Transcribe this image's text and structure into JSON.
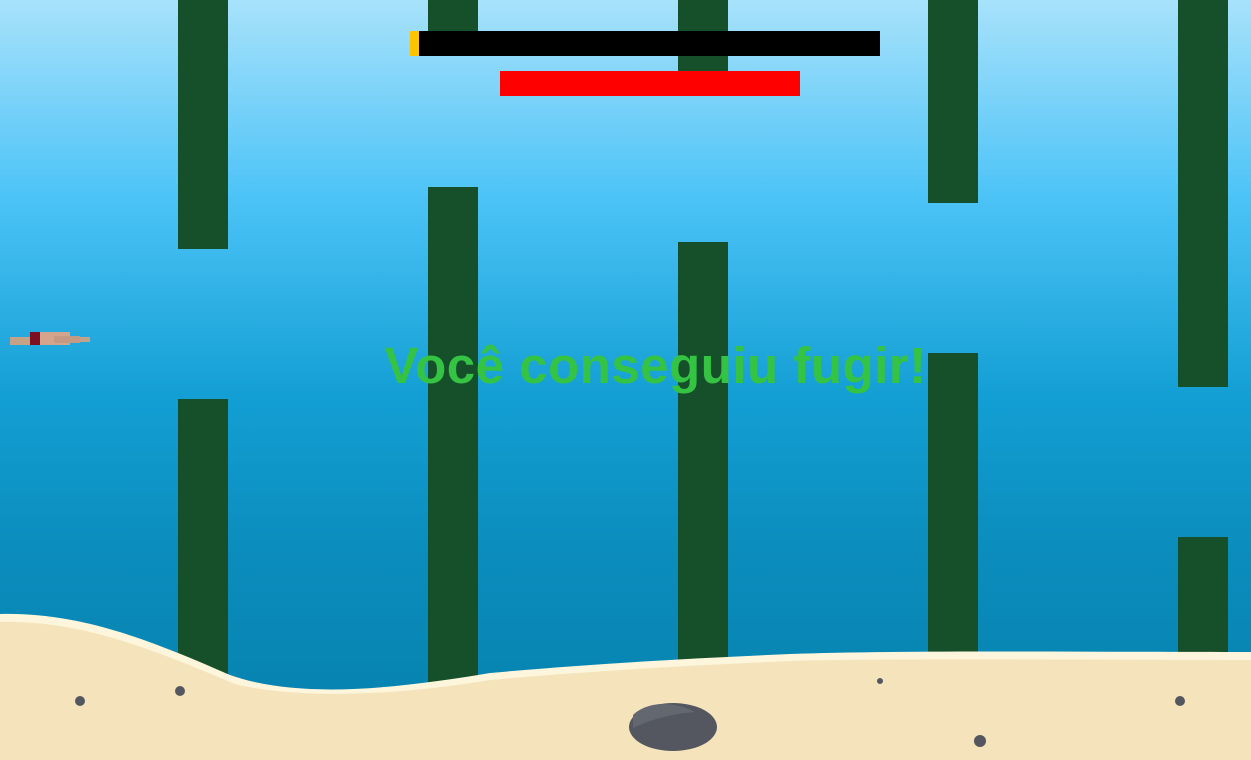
{
  "hud": {
    "progress": 0.02,
    "progress_color": "#ffc400",
    "health": 1.0,
    "health_color": "#ff0000"
  },
  "message": {
    "text": "Você conseguiu fugir!",
    "color": "#35c344"
  },
  "scene": {
    "water_colors": [
      "#a8e2fb",
      "#0580ab"
    ],
    "pillar_color": "#16502a",
    "sand_color": "#f5e4bb",
    "rock_color": "#54575f"
  },
  "player": {
    "icon": "swimmer-icon"
  }
}
